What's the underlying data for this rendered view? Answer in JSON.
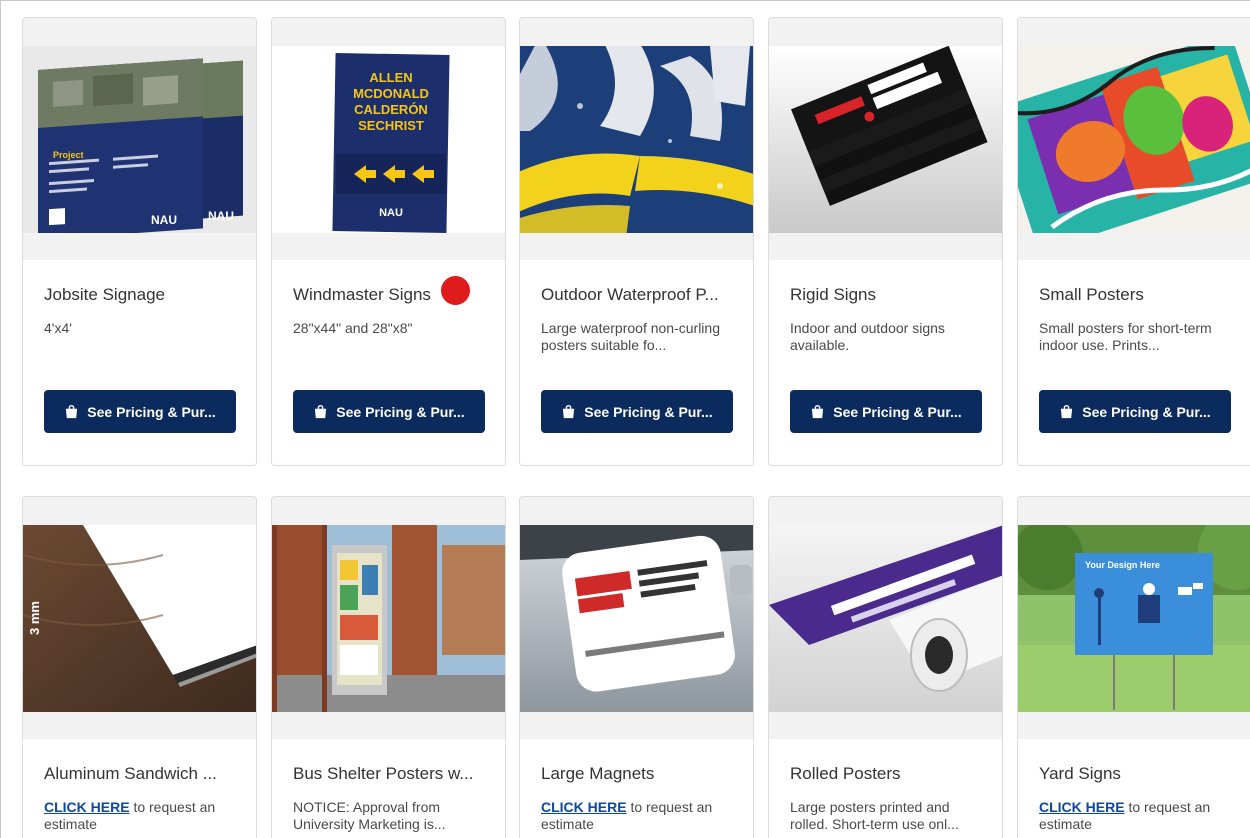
{
  "products": [
    {
      "title": "Jobsite Signage",
      "desc": "4'x4'",
      "button": "See Pricing & Pur...",
      "image": {
        "kind": "jobsite-poster",
        "project_label": "Project",
        "logo": "NAU"
      }
    },
    {
      "title": "Windmaster Signs",
      "desc": "28\"x44\" and 28\"x8\"",
      "button": "See Pricing & Pur...",
      "image": {
        "kind": "windmaster",
        "names": [
          "ALLEN",
          "MCDONALD",
          "CALDERÓN",
          "SECHRIST"
        ],
        "logo": "NAU"
      }
    },
    {
      "title": "Outdoor Waterproof P...",
      "desc": "Large waterproof non-curling posters suitable fo...",
      "button": "See Pricing & Pur...",
      "image": {
        "kind": "waterproof"
      }
    },
    {
      "title": "Rigid Signs",
      "desc": "Indoor and outdoor signs available.",
      "button": "See Pricing & Pur...",
      "image": {
        "kind": "rigid"
      }
    },
    {
      "title": "Small Posters",
      "desc": "Small posters for short-term indoor use. Prints...",
      "button": "See Pricing & Pur...",
      "image": {
        "kind": "small-posters"
      }
    },
    {
      "title": "Aluminum Sandwich ...",
      "desc_link": "CLICK HERE",
      "desc_rest": " to request an estimate",
      "image": {
        "kind": "aluminum",
        "label": "3 mm"
      }
    },
    {
      "title": "Bus Shelter Posters w...",
      "desc": "NOTICE: Approval from University Marketing is...",
      "image": {
        "kind": "bus-shelter"
      }
    },
    {
      "title": "Large Magnets",
      "desc_link": "CLICK HERE",
      "desc_rest": " to request an estimate",
      "image": {
        "kind": "magnets"
      }
    },
    {
      "title": "Rolled Posters",
      "desc": "Large posters printed and rolled. Short-term use onl...",
      "image": {
        "kind": "rolled"
      }
    },
    {
      "title": "Yard Signs",
      "desc_link": "CLICK HERE",
      "desc_rest": " to request an estimate",
      "image": {
        "kind": "yard",
        "caption": "Your Design Here"
      }
    }
  ],
  "colors": {
    "button_bg": "#0b2a5e",
    "link": "#0d47a1",
    "marker": "#e01b1b"
  }
}
